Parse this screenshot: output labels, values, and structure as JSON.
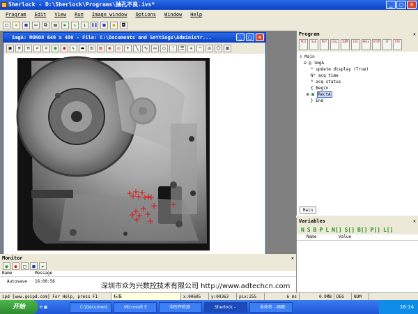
{
  "app": {
    "title": "Sherlock - D:\\Sherlock\\Programs\\抽孔不良.ivs*"
  },
  "menu": [
    "Program",
    "Edit",
    "View",
    "Run",
    "Image window",
    "Options",
    "Window",
    "Help"
  ],
  "image_window": {
    "title": "imgA: MONO8 640 x 480 - File: C:\\Documents and Settings\\Administr..."
  },
  "program_panel": {
    "title": "Program",
    "toolbar_labels": [
      "MCS",
      "Sub",
      "RET",
      "CALL",
      "JUMP",
      "LBL",
      "WHLe",
      "STOP",
      "IF",
      "GTE"
    ],
    "tree": {
      "main": "Main",
      "imgA": "imgA",
      "update": "update display (True)",
      "acq_time": "acq time",
      "acq_status": "acq status",
      "begin": "Begin",
      "rect": "RectA",
      "end": "End"
    },
    "tab": "Main"
  },
  "variables_panel": {
    "title": "Variables",
    "type_buttons": [
      "N",
      "S",
      "B",
      "P",
      "L",
      "N[]",
      "S[]",
      "B[]",
      "P[]",
      "L[]"
    ],
    "columns": [
      "Name",
      "Value"
    ]
  },
  "monitor": {
    "title": "Monitor",
    "columns": [
      "Name",
      "Message"
    ],
    "rows": [
      {
        "name": "Autosave",
        "message": "16:00:56"
      }
    ]
  },
  "watermark": "深圳市众为兴数控技术有限公司 http://www.adtechcn.com",
  "statusbar": {
    "help": "ipd [www.goipd.com] For Help, press F1",
    "ime": "标准",
    "x": "x:00605",
    "y": "y:00363",
    "pix": "pix:255",
    "ms": "6 ms",
    "mem": "0.9MB",
    "deg": "DEG",
    "num": "NUM"
  },
  "taskbar": {
    "start": "开始",
    "tasks": [
      "C:\\Document",
      "Microsoft E",
      "冲压件检测",
      "Sherlock -",
      "未命名 - 画图"
    ],
    "active_index": 3,
    "clock": "16:14"
  },
  "crosshairs": [
    [
      181,
      200
    ],
    [
      186,
      204
    ],
    [
      190,
      198
    ],
    [
      194,
      205
    ],
    [
      199,
      199
    ],
    [
      203,
      206
    ],
    [
      208,
      205
    ],
    [
      212,
      206
    ],
    [
      185,
      231
    ],
    [
      190,
      226
    ],
    [
      195,
      232
    ],
    [
      201,
      222
    ],
    [
      207,
      230
    ],
    [
      211,
      240
    ],
    [
      216,
      218
    ],
    [
      191,
      238
    ],
    [
      244,
      216
    ]
  ]
}
